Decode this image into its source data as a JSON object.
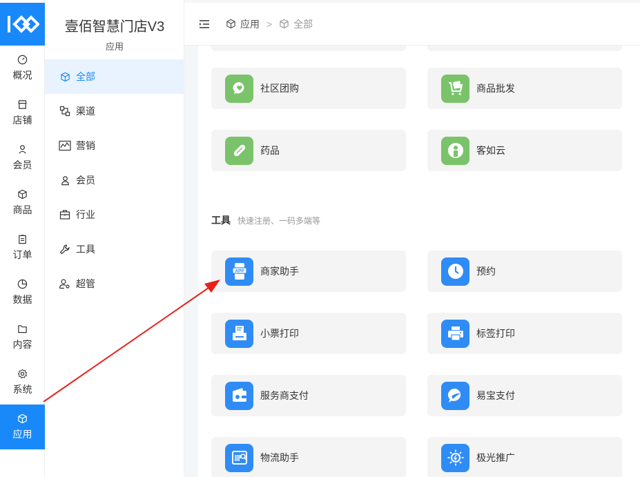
{
  "app": {
    "title": "壹佰智慧门店V3",
    "subtitle": "应用"
  },
  "rail": [
    {
      "label": "概况",
      "icon": "dashboard-icon"
    },
    {
      "label": "店铺",
      "icon": "store-icon"
    },
    {
      "label": "会员",
      "icon": "user-icon"
    },
    {
      "label": "商品",
      "icon": "box-icon"
    },
    {
      "label": "订单",
      "icon": "clipboard-icon"
    },
    {
      "label": "数据",
      "icon": "pie-chart-icon"
    },
    {
      "label": "内容",
      "icon": "folder-icon"
    },
    {
      "label": "系统",
      "icon": "gear-icon"
    },
    {
      "label": "应用",
      "icon": "cube-icon",
      "active": true
    }
  ],
  "side_menu": [
    {
      "label": "全部",
      "icon": "cube-icon",
      "active": true
    },
    {
      "label": "渠道",
      "icon": "channel-icon"
    },
    {
      "label": "营销",
      "icon": "trend-icon"
    },
    {
      "label": "会员",
      "icon": "user-icon"
    },
    {
      "label": "行业",
      "icon": "briefcase-icon"
    },
    {
      "label": "工具",
      "icon": "wrench-icon"
    },
    {
      "label": "超管",
      "icon": "admin-icon"
    }
  ],
  "breadcrumb": {
    "root": "应用",
    "separator": ">",
    "current": "全部"
  },
  "apps_top": [
    {
      "label": "社区团购",
      "icon": "chat-heart-icon",
      "color": "#7ac36a"
    },
    {
      "label": "商品批发",
      "icon": "cart-icon",
      "color": "#7ac36a"
    },
    {
      "label": "药品",
      "icon": "pill-icon",
      "color": "#7ac36a"
    },
    {
      "label": "客如云",
      "icon": "person-badge-icon",
      "color": "#7ac36a"
    }
  ],
  "tools_section": {
    "title": "工具",
    "desc": "快速注册、一码多端等"
  },
  "tools": [
    {
      "label": "商家助手",
      "icon": "app-phone-icon",
      "color": "#2f8cf4"
    },
    {
      "label": "预约",
      "icon": "clock-icon",
      "color": "#2f8cf4"
    },
    {
      "label": "小票打印",
      "icon": "receipt-printer-icon",
      "color": "#2f8cf4"
    },
    {
      "label": "标签打印",
      "icon": "printer-icon",
      "color": "#2f8cf4"
    },
    {
      "label": "服务商支付",
      "icon": "wallet-icon",
      "color": "#2f8cf4"
    },
    {
      "label": "易宝支付",
      "icon": "chat-check-icon",
      "color": "#2f8cf4"
    },
    {
      "label": "物流助手",
      "icon": "barcode-search-icon",
      "color": "#2f8cf4"
    },
    {
      "label": "极光推广",
      "icon": "sun-icon",
      "color": "#2f8cf4"
    }
  ],
  "colors": {
    "accent": "#1989fa",
    "annotation": "#e8221a"
  }
}
